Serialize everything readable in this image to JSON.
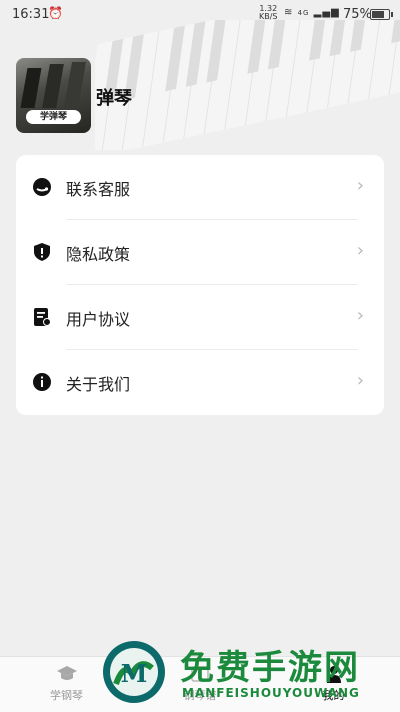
{
  "status_bar": {
    "time": "16:31",
    "net_speed_value": "1.32",
    "net_speed_unit": "KB/S",
    "network": "4G",
    "battery": "75%"
  },
  "profile": {
    "app_name": "弹琴",
    "avatar_badge": "学弹琴"
  },
  "menu": {
    "items": [
      {
        "label": "联系客服",
        "icon": "headset-icon"
      },
      {
        "label": "隐私政策",
        "icon": "shield-icon"
      },
      {
        "label": "用户协议",
        "icon": "document-icon"
      },
      {
        "label": "关于我们",
        "icon": "info-icon"
      }
    ]
  },
  "tabbar": {
    "tabs": [
      {
        "label": "学钢琴",
        "icon": "graduation-cap-icon",
        "active": false
      },
      {
        "label": "钢琴谱",
        "icon": "music-score-icon",
        "active": false
      },
      {
        "label": "我的",
        "icon": "person-icon",
        "active": true
      }
    ]
  },
  "watermark": {
    "title": "免费手游网",
    "subtitle": "MANFEISHOUYOUWANG",
    "logo_letter": "M"
  },
  "colors": {
    "background": "#efefef",
    "card": "#ffffff",
    "watermark_green": "#1b8a3c",
    "watermark_teal": "#0c6a6a"
  }
}
